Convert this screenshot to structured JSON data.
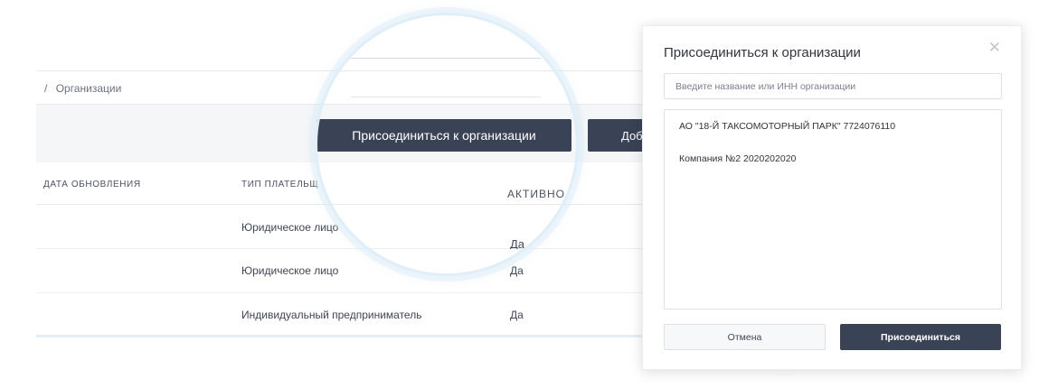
{
  "breadcrumb": {
    "separator": "/",
    "current": "Организации"
  },
  "toolbar": {
    "join_label": "Присоединиться к организации",
    "add_label": "Доб"
  },
  "table": {
    "headers": {
      "date": "ДАТА ОБНОВЛЕНИЯ",
      "type": "ТИП ПЛАТЕЛЬЩ",
      "active": "АКТИВНО"
    },
    "rows": [
      {
        "type": "Юридическое лицо",
        "active": "Да"
      },
      {
        "type": "Юридическое лицо",
        "active": "Да"
      },
      {
        "type": "Индивидуальный предприниматель",
        "active": "Да"
      }
    ]
  },
  "modal": {
    "title": "Присоединиться к организации",
    "close_icon": "close-icon",
    "search": {
      "placeholder": "Введите название или ИНН организации",
      "value": ""
    },
    "results": [
      "АО \"18-Й ТАКСОМОТОРНЫЙ ПАРК\" 7724076110",
      "Компания №2 2020202020"
    ],
    "cancel_label": "Отмена",
    "join_label": "Присоединиться"
  },
  "colors": {
    "accent_dark": "#3a4356",
    "lens_ring": "#dfeef8"
  }
}
